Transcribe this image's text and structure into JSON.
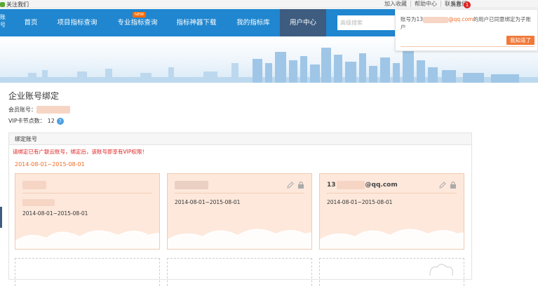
{
  "topbar": {
    "follow": "关注我们",
    "links": [
      "加入收藏",
      "帮助中心",
      "联系我们"
    ],
    "messages_label": "消息",
    "messages_count": "1"
  },
  "nav": {
    "edge_text": "账号",
    "items": [
      {
        "label": "首页"
      },
      {
        "label": "项目指标查询"
      },
      {
        "label": "专业指标查询",
        "tag": "NEW"
      },
      {
        "label": "指标神器下载"
      },
      {
        "label": "我的指标库"
      },
      {
        "label": "用户中心",
        "active": true
      }
    ],
    "search_placeholder": "高级搜索"
  },
  "page": {
    "title": "企业账号绑定",
    "member_label": "会员账号：",
    "vip_label": "VIP卡节点数：",
    "vip_value": "12",
    "help_glyph": "?"
  },
  "panel": {
    "header": "绑定账号",
    "warning": "请绑定已有广联云账号，绑定后，该账号即享有VIP权限！",
    "date_range": "2014-08-01~2015-08-01",
    "cards": [
      {
        "title_prefix": "",
        "title_suffix": "",
        "date": "2014-08-01~2015-08-01",
        "tools": false
      },
      {
        "title_prefix": "",
        "title_suffix": "",
        "date": "2014-08-01~2015-08-01",
        "tools": true
      },
      {
        "title_prefix": "13",
        "title_suffix": "@qq.com",
        "date": "2014-08-01~2015-08-01",
        "tools": true
      }
    ]
  },
  "popup": {
    "text_before": "账号为13",
    "text_email": "@qq.com",
    "text_after": "的用户已同意绑定为子账户",
    "ok_label": "我知道了"
  },
  "colors": {
    "nav_bg": "#1f86cf",
    "nav_active": "#3d5c7f",
    "card_bg": "#fde8db",
    "accent_orange": "#f06a20",
    "warning_red": "#e02020"
  },
  "icons": [
    "edit-icon",
    "lock-icon",
    "help-icon",
    "follow-icon"
  ]
}
